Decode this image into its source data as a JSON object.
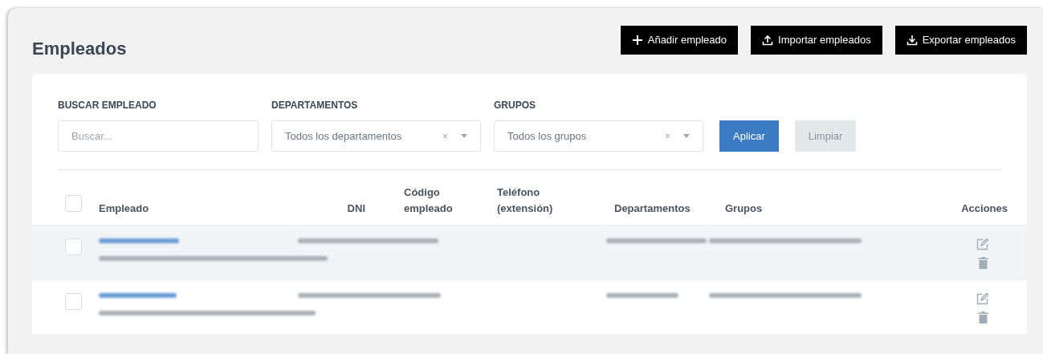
{
  "page": {
    "title": "Empleados"
  },
  "header_buttons": [
    {
      "label": "Añadir empleado"
    },
    {
      "label": "Importar empleados"
    },
    {
      "label": "Exportar empleados"
    }
  ],
  "filters": {
    "search": {
      "label": "BUSCAR EMPLEADO",
      "placeholder": "Buscar..."
    },
    "departments": {
      "label": "DEPARTAMENTOS",
      "value": "Todos los departamentos",
      "clear": "×"
    },
    "groups": {
      "label": "GRUPOS",
      "value": "Todos los grupos",
      "clear": "×"
    },
    "apply": {
      "label": "Aplicar"
    },
    "clear_button": {
      "label": "Limpiar",
      "disabled": true
    }
  },
  "table": {
    "select_all_checked": false,
    "columns": [
      "Empleado",
      "DNI",
      "Código empleado",
      "Teléfono (extensión)",
      "Departamentos",
      "Grupos",
      "Acciones"
    ],
    "rows": [
      {
        "checked": false
      },
      {
        "checked": false
      }
    ]
  }
}
